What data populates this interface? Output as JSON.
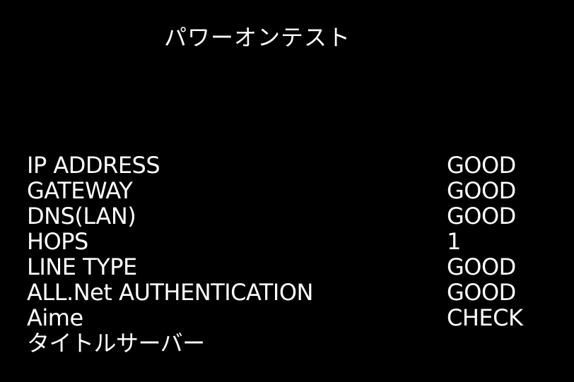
{
  "title": "パワーオンテスト",
  "tests": [
    {
      "label": "IP ADDRESS",
      "value": "GOOD"
    },
    {
      "label": "GATEWAY",
      "value": "GOOD"
    },
    {
      "label": "DNS(LAN)",
      "value": "GOOD"
    },
    {
      "label": "HOPS",
      "value": "1"
    },
    {
      "label": "LINE TYPE",
      "value": "GOOD"
    },
    {
      "label": "ALL.Net AUTHENTICATION",
      "value": "GOOD"
    },
    {
      "label": "Aime",
      "value": "CHECK"
    },
    {
      "label": "タイトルサーバー",
      "value": ""
    }
  ],
  "colors": {
    "background": "#000000",
    "text": "#ffffff"
  }
}
